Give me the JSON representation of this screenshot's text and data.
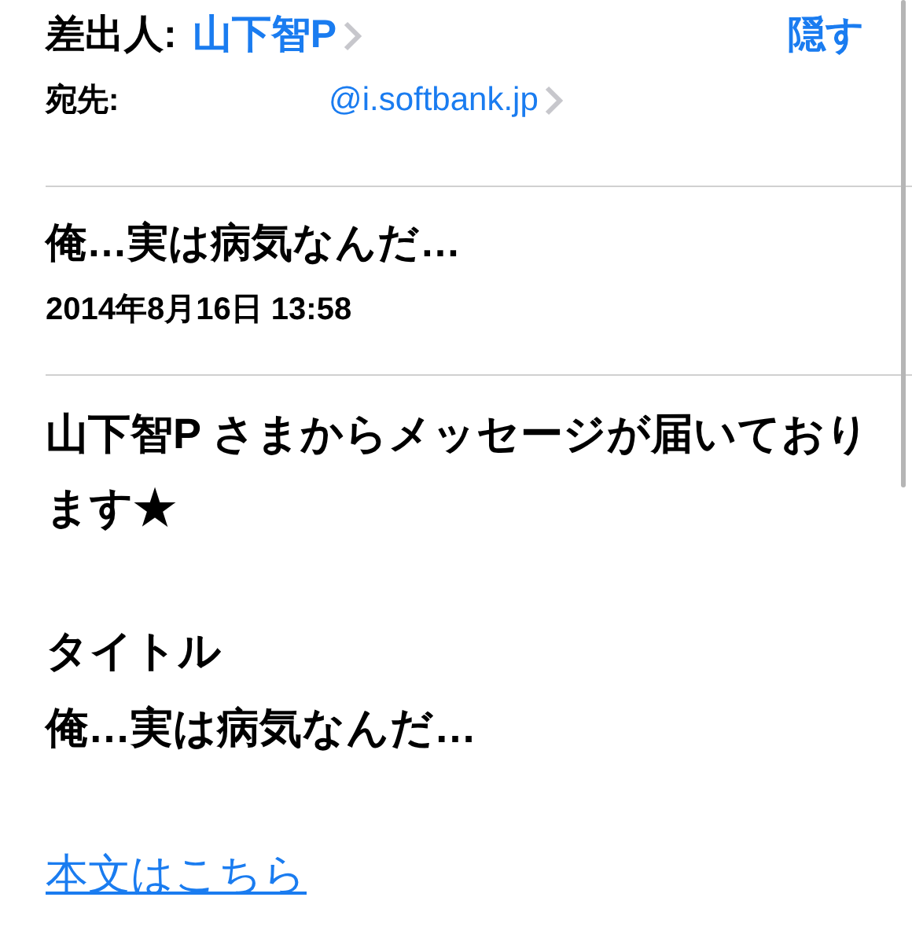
{
  "header": {
    "from_label": "差出人:",
    "from_name": "山下智P",
    "hide_button": "隠す",
    "to_label": "宛先:",
    "to_address": "@i.softbank.jp"
  },
  "subject": "俺…実は病気なんだ…",
  "date": "2014年8月16日 13:58",
  "body": [
    {
      "kind": "text",
      "text": "山下智P さまからメッセージが届いております★"
    },
    {
      "kind": "text",
      "text": "タイトル"
    },
    {
      "kind": "text",
      "text": "俺…実は病気なんだ…"
    },
    {
      "kind": "link",
      "text": "本文はこちら"
    }
  ]
}
